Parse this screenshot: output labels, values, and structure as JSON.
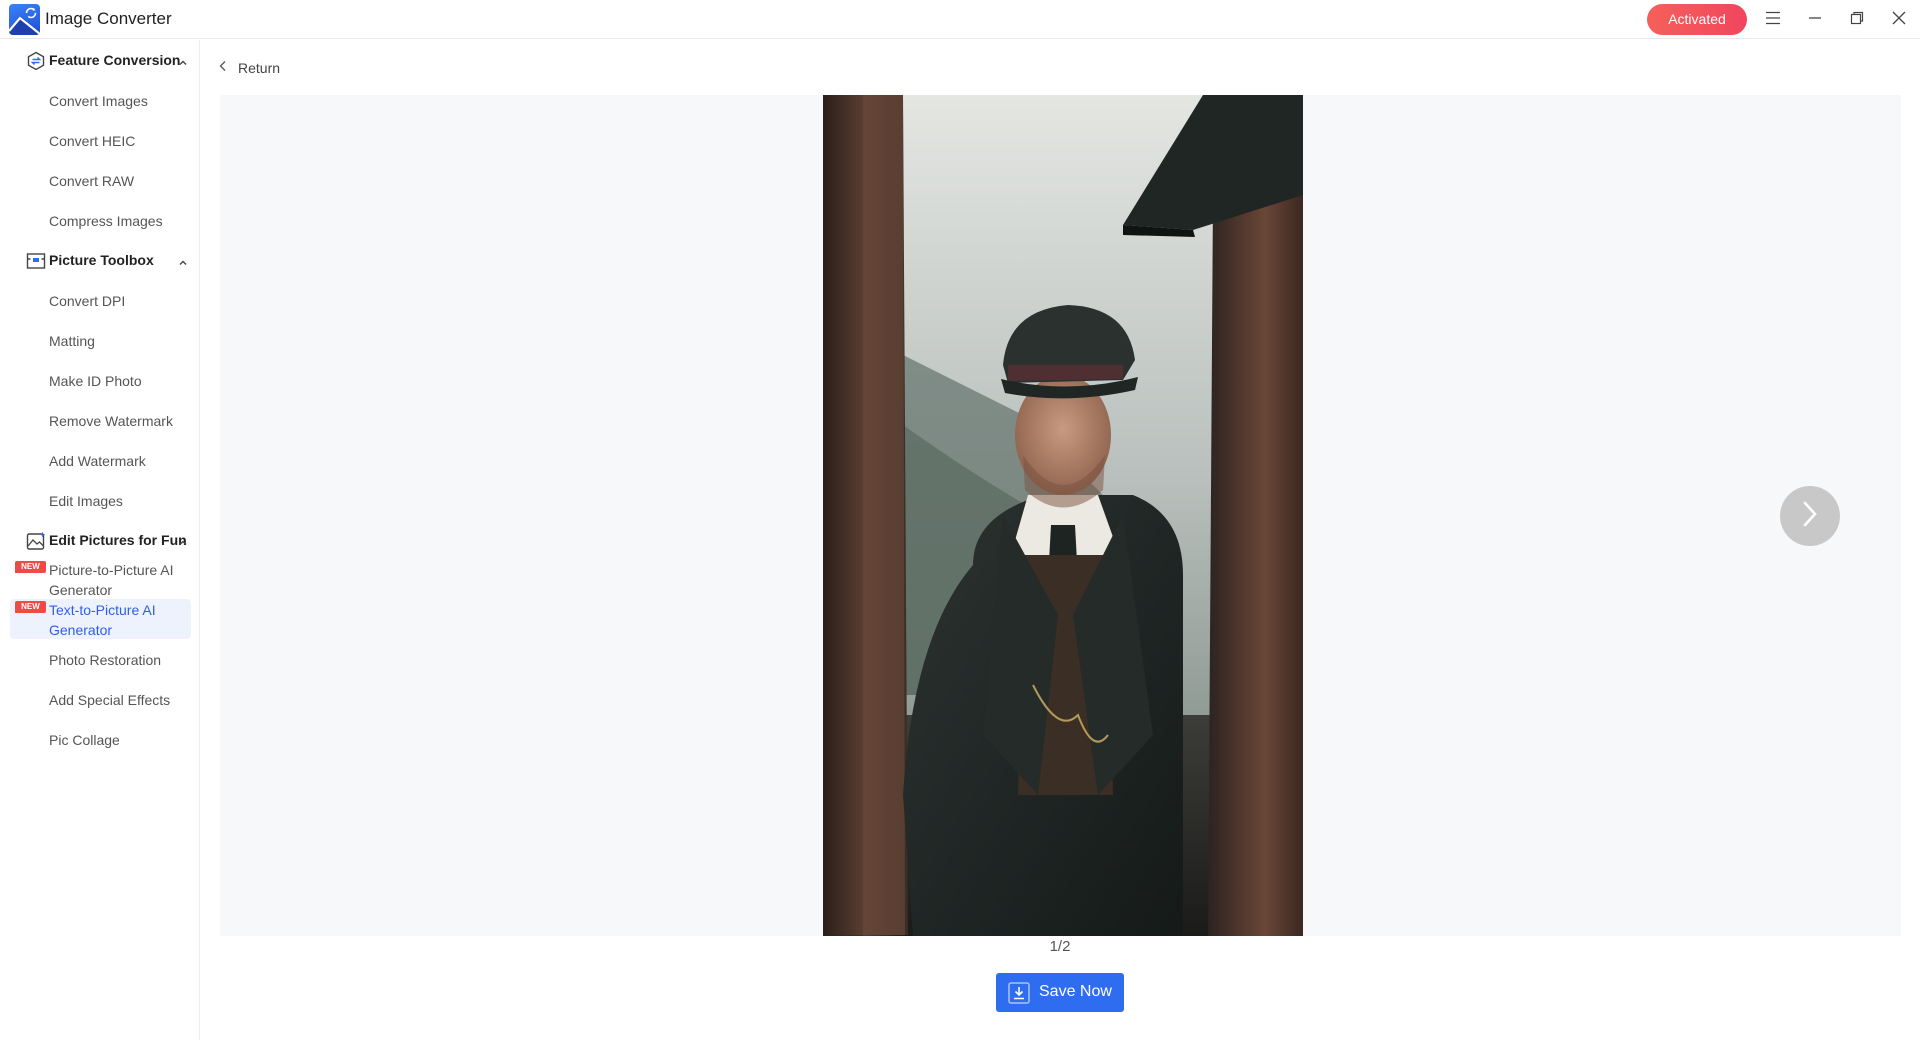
{
  "app": {
    "title": "Image Converter",
    "logo_icon": "image-sync-icon"
  },
  "titlebar": {
    "activated_label": "Activated",
    "activated_color": "#f2515c",
    "menu_icon": "hamburger-menu-icon",
    "minimize_icon": "minimize-icon",
    "restore_icon": "restore-icon",
    "close_icon": "close-icon"
  },
  "sidebar": {
    "groups": [
      {
        "label": "Feature Conversion",
        "icon": "convert-hexagon-icon",
        "expanded": true,
        "items": [
          {
            "label": "Convert Images"
          },
          {
            "label": "Convert HEIC"
          },
          {
            "label": "Convert RAW"
          },
          {
            "label": "Compress Images"
          }
        ]
      },
      {
        "label": "Picture Toolbox",
        "icon": "toolbox-icon",
        "expanded": true,
        "items": [
          {
            "label": "Convert DPI"
          },
          {
            "label": "Matting"
          },
          {
            "label": "Make ID Photo"
          },
          {
            "label": "Remove Watermark"
          },
          {
            "label": "Add Watermark"
          },
          {
            "label": "Edit Images"
          }
        ]
      },
      {
        "label": "Edit Pictures for Fun",
        "icon": "picture-sparkle-icon",
        "expanded": true,
        "items": [
          {
            "label": "Picture-to-Picture AI Generator",
            "badge": "NEW"
          },
          {
            "label": "Text-to-Picture AI Generator",
            "badge": "NEW",
            "active": true
          },
          {
            "label": "Photo Restoration"
          },
          {
            "label": "Add Special Effects"
          },
          {
            "label": "Pic Collage"
          }
        ]
      }
    ]
  },
  "main": {
    "return_label": "Return",
    "page_indicator": "1/2",
    "current_page": 1,
    "total_pages": 2,
    "save_label": "Save Now",
    "accent_color": "#2f6df0",
    "photo_description": "Generated portrait: man in flat cap and dark wool overcoat on a rainy brick street"
  }
}
